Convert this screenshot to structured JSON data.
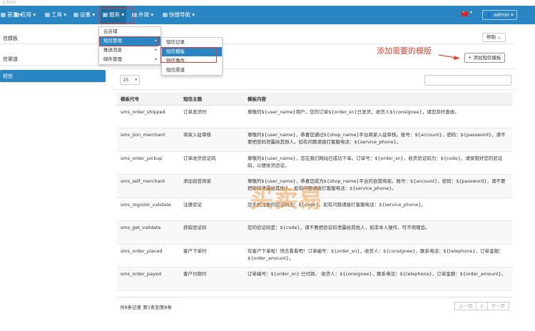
{
  "window": {
    "title_fragment": "ji-timt"
  },
  "nav": {
    "items": [
      {
        "label": "首页",
        "icon": "grid-icon",
        "caret": "▾"
      },
      {
        "label": "应用",
        "icon": "grid-icon",
        "caret": "▾"
      },
      {
        "label": "工具",
        "icon": "grid-icon",
        "caret": "▾"
      },
      {
        "label": "设置",
        "icon": "grid-icon",
        "caret": "▾"
      },
      {
        "label": "服务",
        "icon": "grid-icon",
        "caret": "▾"
      },
      {
        "label": "外观",
        "icon": "grid-icon",
        "caret": "▾"
      },
      {
        "label": "快捷导航",
        "icon": "grid-icon",
        "caret": "▾"
      }
    ],
    "user": "admin ▾",
    "language_caret": "▾"
  },
  "breadcrumb": "信模板",
  "help_button": "帮助 ⌄",
  "left_menu": {
    "items": [
      "信渠道",
      "短信"
    ]
  },
  "service_menu": {
    "items": [
      {
        "label": "云店铺",
        "sub": ""
      },
      {
        "label": "短信管理",
        "sub": "▸"
      },
      {
        "label": "推送消息",
        "sub": "▸"
      },
      {
        "label": "邮件管理",
        "sub": "▸"
      }
    ]
  },
  "sms_submenu": {
    "items": [
      "短信记录",
      "短信模板",
      "短信事件",
      "短信渠道"
    ]
  },
  "annotation": "添加需要的模版",
  "add_button": "+ 添加短信模板",
  "page_size": {
    "value": "15",
    "caret": "▾"
  },
  "table": {
    "headers": [
      "模板代号",
      "短信主题",
      "模板内容"
    ],
    "rows": [
      [
        "sms_order_shipped",
        "订单发货时",
        "尊敬的${user_name}用户，您的订单${order_sn}已发货，收货人${consignee}，请您及时查收。"
      ],
      [
        "sms_jion_merchant",
        "商家入驻审核",
        "尊敬的${user_name}，恭喜您通过${shop_name}平台商家入驻审核。账号：${account}，密码：${password}，请不要把密码泄露给其他人。如有问题请拨打客服电话：${service_phone}。"
      ],
      [
        "sms_order_pickup",
        "订单收货验证码",
        "尊敬的${user_name}，您在我们网站已成功下单。订单号：${order_sn}，收货验证码为：${code}。请保管好您的验证码，以便收货验证。"
      ],
      [
        "sms_self_merchant",
        "添加自营商家",
        "尊敬的${user_name}，恭喜您成为${shop_name}平台的自营商家。账号：${account}，密码：${password}，请不要把密码泄露给其他人。如有问题请拨打客服电话：${service_phone}。"
      ],
      [
        "sms_register_validate",
        "注册验证",
        "您手机注册的验证码为：${code}，如有问题请拨打客服电话：${service_phone}。"
      ],
      [
        "sms_get_validate",
        "获取验证码",
        "您的验证码是：${code}，请不要把验证码泄露给其他人，如非本人操作，可不用理会。"
      ],
      [
        "sms_order_placed",
        "客户下单时",
        "有客户下单啦！快去看看吧！订单编号：${order_sn}，收货人：${consignee}，联系电话：${telephone}，订单金额：${order_amount}。"
      ],
      [
        "sms_order_payed",
        "客户付款时",
        "订单编号：${order_sn} 已付款。 收货人：${consignee}，联系电话：${telephone}，订单金额：${order_amount}。"
      ]
    ]
  },
  "footer": {
    "summary": "共8条记录 第1条到第8条",
    "prev": "上一页",
    "page": "1",
    "next": "下一页"
  },
  "watermark": "买卖易",
  "colors": {
    "navbar": "#2a86c2",
    "annotation": "#e8432f",
    "highlight_box": "#e03b3b"
  }
}
